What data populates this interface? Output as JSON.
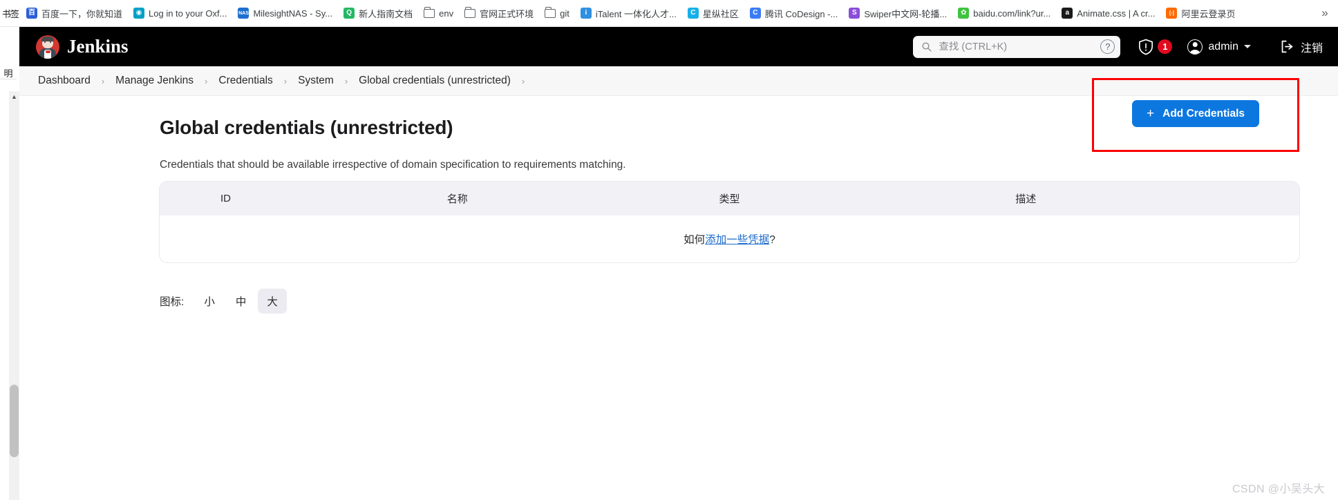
{
  "browser": {
    "bookmarks_label": "书签",
    "side_panel_label": "明",
    "overflow_label": "»",
    "bookmarks": [
      {
        "title": "百度一下，你就知道",
        "icon": "baidu-icon",
        "color": "#2b5fd9",
        "glyph": "百",
        "type": "site"
      },
      {
        "title": "Log in to your Oxf...",
        "icon": "oxford-icon",
        "color": "#00a0c6",
        "glyph": "◉",
        "type": "site"
      },
      {
        "title": "MilesightNAS - Sy...",
        "icon": "milesight-icon",
        "color": "#1d6fd0",
        "glyph": "NAS",
        "type": "site"
      },
      {
        "title": "新人指南文档",
        "icon": "yuque-icon",
        "color": "#25b864",
        "glyph": "Q",
        "type": "site"
      },
      {
        "title": "env",
        "icon": "folder-icon",
        "type": "folder"
      },
      {
        "title": "官网正式环境",
        "icon": "folder-icon",
        "type": "folder"
      },
      {
        "title": "git",
        "icon": "folder-icon",
        "type": "folder"
      },
      {
        "title": "iTalent 一体化人才...",
        "icon": "italent-icon",
        "color": "#2f8fe0",
        "glyph": "i",
        "type": "site"
      },
      {
        "title": "星纵社区",
        "icon": "community-icon",
        "color": "#16b0e8",
        "glyph": "C",
        "type": "site"
      },
      {
        "title": "腾讯 CoDesign -...",
        "icon": "codesign-icon",
        "color": "#3b7cf5",
        "glyph": "C",
        "type": "site"
      },
      {
        "title": "Swiper中文网-轮播...",
        "icon": "swiper-icon",
        "color": "#8a4ddb",
        "glyph": "S",
        "type": "site"
      },
      {
        "title": "baidu.com/link?ur...",
        "icon": "baidu-link-icon",
        "color": "#3ec43e",
        "glyph": "✿",
        "type": "site"
      },
      {
        "title": "Animate.css | A cr...",
        "icon": "animate-icon",
        "color": "#1a1a1a",
        "glyph": "a",
        "type": "site"
      },
      {
        "title": "阿里云登录页",
        "icon": "aliyun-icon",
        "color": "#ff6a00",
        "glyph": "[-]",
        "type": "site"
      }
    ]
  },
  "header": {
    "brand": "Jenkins",
    "logo_icon": "jenkins-butler-logo",
    "search": {
      "placeholder": "查找 (CTRL+K)",
      "value": "",
      "icon": "search-icon"
    },
    "help_icon": "help-question-icon",
    "help_label": "?",
    "security_icon": "shield-warning-icon",
    "security_badge": "1",
    "user": {
      "name": "admin",
      "avatar_icon": "user-avatar-icon",
      "caret_icon": "chevron-down-icon"
    },
    "logout": {
      "label": "注销",
      "icon": "logout-arrow-icon"
    }
  },
  "breadcrumbs": [
    "Dashboard",
    "Manage Jenkins",
    "Credentials",
    "System",
    "Global credentials (unrestricted)"
  ],
  "breadcrumb_separator": "›",
  "main": {
    "title": "Global credentials (unrestricted)",
    "description": "Credentials that should be available irrespective of domain specification to requirements matching.",
    "add_button": {
      "label": "Add Credentials",
      "plus_icon": "plus-icon",
      "color": "#0d77e0",
      "highlight_border_color": "#fb0000"
    },
    "table": {
      "headers": [
        "ID",
        "名称",
        "类型",
        "描述"
      ],
      "rows": [],
      "empty_text_prefix": "如何",
      "empty_link_text": "添加一些凭据",
      "empty_text_suffix": "?",
      "empty_link_color": "#1b6ac9"
    },
    "icon_size": {
      "label": "图标:",
      "options": [
        {
          "label": "小",
          "selected": false
        },
        {
          "label": "中",
          "selected": false
        },
        {
          "label": "大",
          "selected": true
        }
      ]
    }
  },
  "watermark": "CSDN @小吴头大"
}
